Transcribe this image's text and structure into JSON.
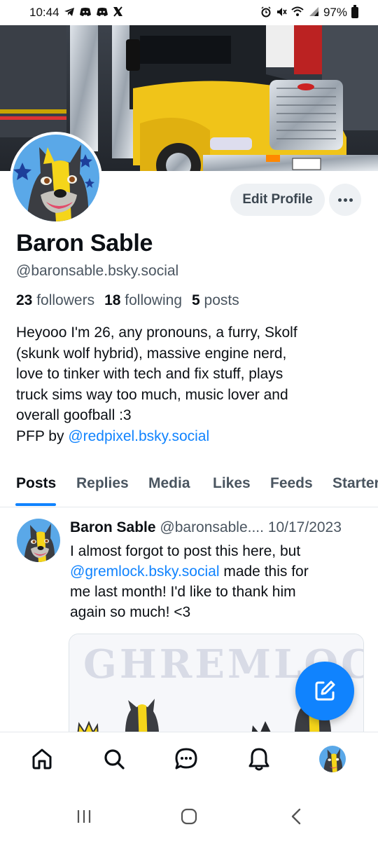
{
  "status_bar": {
    "time": "10:44",
    "left_icons": [
      "telegram-icon",
      "discord-icon",
      "discord-icon",
      "x-icon"
    ],
    "right_icons": [
      "alarm-icon",
      "mute-icon",
      "wifi-icon",
      "signal-icon"
    ],
    "battery": "97%"
  },
  "profile": {
    "display_name": "Baron Sable",
    "handle": "@baronsable.bsky.social",
    "followers_count": "23",
    "followers_label": "followers",
    "following_count": "18",
    "following_label": "following",
    "posts_count": "5",
    "posts_label": "posts",
    "bio_lines": [
      "Heyooo I'm 26, any pronouns, a furry, Skolf",
      "(skunk wolf hybrid), massive engine nerd,",
      "love to tinker with tech and fix stuff, plays",
      "truck sims way too much, music lover and",
      "overall goofball :3"
    ],
    "pfp_prefix": "PFP by ",
    "pfp_link": "@redpixel.bsky.social",
    "edit_label": "Edit Profile"
  },
  "tabs": [
    "Posts",
    "Replies",
    "Media",
    "Likes",
    "Feeds",
    "Starter"
  ],
  "active_tab": "Posts",
  "post": {
    "author": "Baron Sable",
    "handle": "@baronsable....",
    "date": "10/17/2023",
    "mention": "@gremlock.bsky.social",
    "text_line1": "I almost forgot to post this here, but",
    "text_after_mention": " made this for",
    "text_line3": "me last month! I'd like to thank him",
    "text_line4": "again so much! <3",
    "image_watermark": "GHREMLOCK"
  },
  "bottom_nav": [
    "home-icon",
    "search-icon",
    "chat-icon",
    "notifications-icon",
    "profile-avatar"
  ],
  "colors": {
    "accent": "#1083fe",
    "text_primary": "#0b0f14",
    "text_secondary": "#4a5560",
    "button_bg": "#eef1f4"
  }
}
